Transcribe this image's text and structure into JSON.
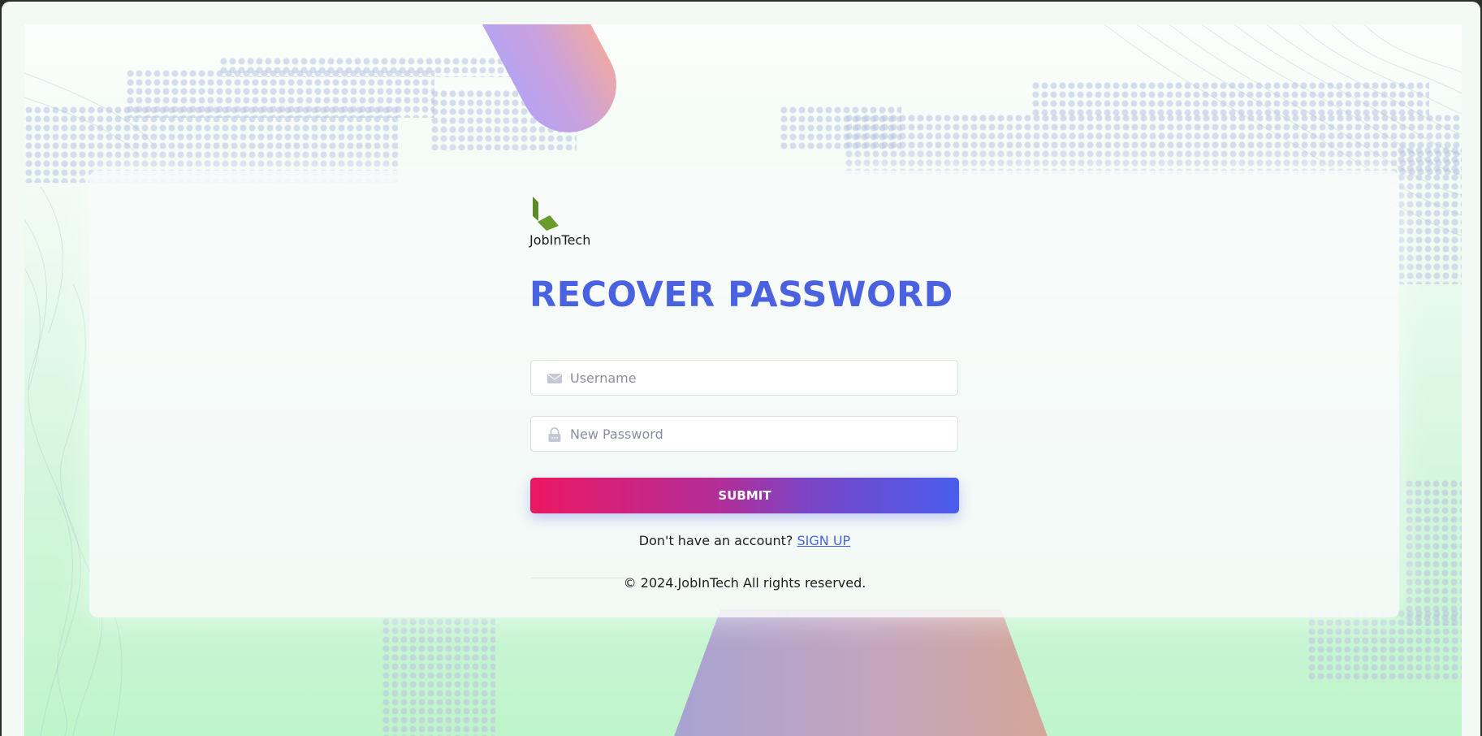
{
  "brand": {
    "name": "JobInTech",
    "logo_colors": [
      "#5b8a26",
      "#6a9b2c"
    ]
  },
  "form": {
    "title": "RECOVER PASSWORD",
    "username_placeholder": "Username",
    "password_placeholder": "New Password",
    "submit_label": "SUBMIT"
  },
  "signup": {
    "prompt": "Don't have an account?",
    "link_label": "SIGN UP"
  },
  "footer": {
    "copyright": "© 2024.JobInTech All rights reserved."
  },
  "colors": {
    "accent": "#4b62e0",
    "submit_gradient_start": "#ec1763",
    "submit_gradient_end": "#4a5ded"
  },
  "icons": {
    "username": "mail-icon",
    "password": "lock-icon"
  }
}
